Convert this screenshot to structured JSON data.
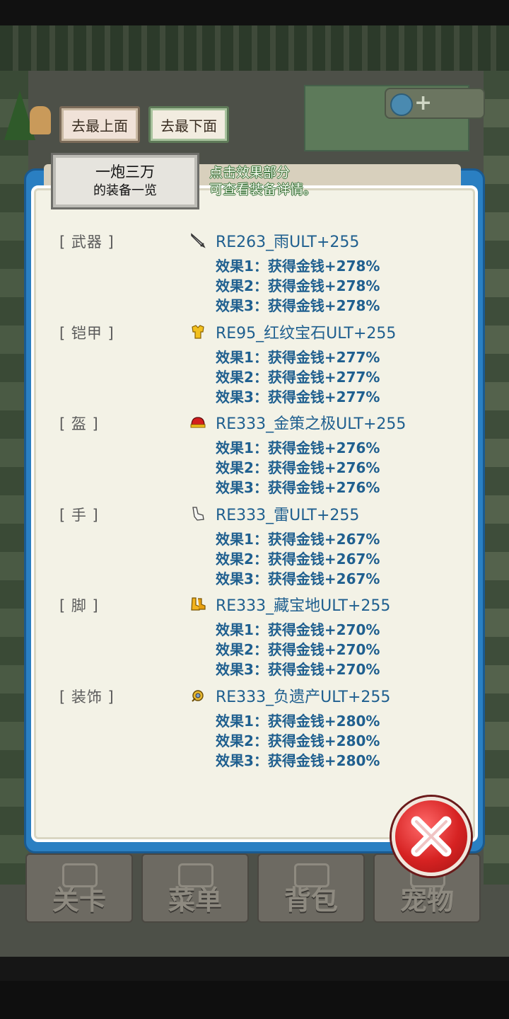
{
  "nav": {
    "go_top": "去最上面",
    "go_bottom": "去最下面"
  },
  "panel": {
    "title_line1": "一炮三万",
    "title_line2": "的装备一览",
    "hint_line1": "点击效果部分",
    "hint_line2": "可查看装备详情。"
  },
  "equipment": [
    {
      "slot": "[ 武器 ]",
      "icon": "sword-icon",
      "name": "RE263_雨ULT+255",
      "effects": [
        "效果1：获得金钱+278%",
        "效果2：获得金钱+278%",
        "效果3：获得金钱+278%"
      ]
    },
    {
      "slot": "[ 铠甲 ]",
      "icon": "armor-icon",
      "name": "RE95_红纹宝石ULT+255",
      "effects": [
        "效果1：获得金钱+277%",
        "效果2：获得金钱+277%",
        "效果3：获得金钱+277%"
      ]
    },
    {
      "slot": "[ 盔 ]",
      "icon": "helmet-icon",
      "name": "RE333_金策之极ULT+255",
      "effects": [
        "效果1：获得金钱+276%",
        "效果2：获得金钱+276%",
        "效果3：获得金钱+276%"
      ]
    },
    {
      "slot": "[ 手 ]",
      "icon": "gauntlet-icon",
      "name": "RE333_雷ULT+255",
      "effects": [
        "效果1：获得金钱+267%",
        "效果2：获得金钱+267%",
        "效果3：获得金钱+267%"
      ]
    },
    {
      "slot": "[ 脚 ]",
      "icon": "boots-icon",
      "name": "RE333_藏宝地ULT+255",
      "effects": [
        "效果1：获得金钱+270%",
        "效果2：获得金钱+270%",
        "效果3：获得金钱+270%"
      ]
    },
    {
      "slot": "[ 装饰 ]",
      "icon": "accessory-icon",
      "name": "RE333_负遗产ULT+255",
      "effects": [
        "效果1：获得金钱+280%",
        "效果2：获得金钱+280%",
        "效果3：获得金钱+280%"
      ]
    }
  ],
  "bottom_menu": {
    "stage": "关卡",
    "menu": "菜单",
    "bag": "背包",
    "pet": "宠物"
  },
  "colors": {
    "panel_border": "#2a7fc2",
    "item_text": "#1f5f8f",
    "close_button": "#d62222"
  }
}
